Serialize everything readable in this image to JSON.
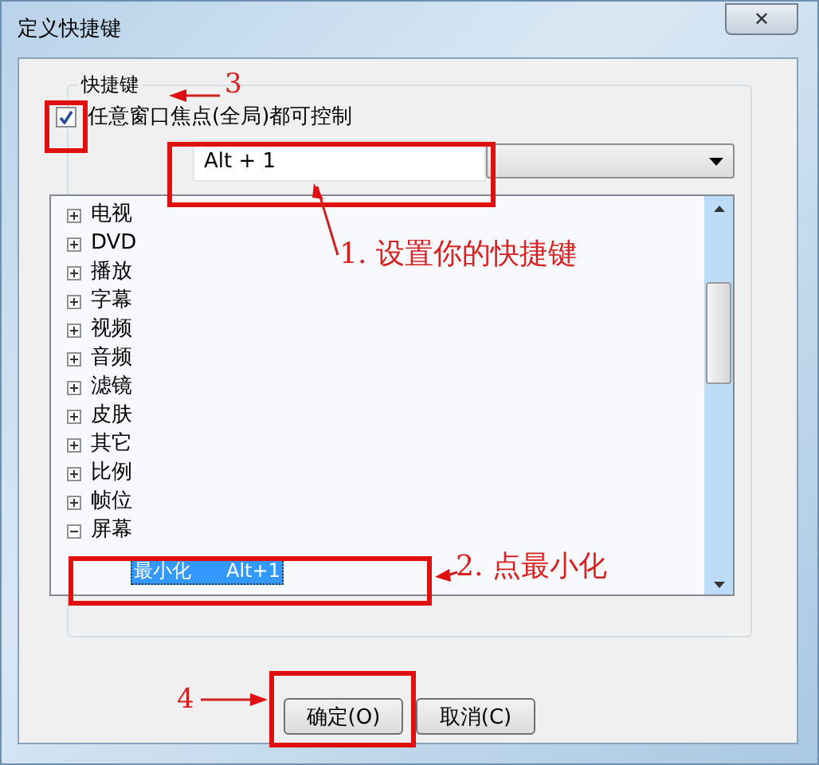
{
  "window": {
    "title": "定义快捷键",
    "close": "✕"
  },
  "group": {
    "title": "快捷键"
  },
  "global_control": {
    "label": "任意窗口焦点(全局)都可控制",
    "checked": true
  },
  "shortcut_field": {
    "value": "Alt + 1"
  },
  "tree": [
    {
      "label": "电视",
      "expanded": false
    },
    {
      "label": "DVD",
      "expanded": false
    },
    {
      "label": "播放",
      "expanded": false
    },
    {
      "label": "字幕",
      "expanded": false
    },
    {
      "label": "视频",
      "expanded": false
    },
    {
      "label": "音频",
      "expanded": false
    },
    {
      "label": "滤镜",
      "expanded": false
    },
    {
      "label": "皮肤",
      "expanded": false
    },
    {
      "label": "其它",
      "expanded": false
    },
    {
      "label": "比例",
      "expanded": false
    },
    {
      "label": "帧位",
      "expanded": false
    },
    {
      "label": "屏幕",
      "expanded": true,
      "children": [
        {
          "label": "最小化",
          "shortcut": "Alt+1",
          "selected": true
        }
      ]
    }
  ],
  "buttons": [
    "确定(O)",
    "取消(C)"
  ],
  "annotations": [
    {
      "kind": "callout",
      "text": "1. 设置你的快捷键"
    },
    {
      "kind": "callout",
      "text": "2. 点最小化"
    },
    {
      "kind": "number",
      "text": "3"
    },
    {
      "kind": "number",
      "text": "4"
    }
  ]
}
